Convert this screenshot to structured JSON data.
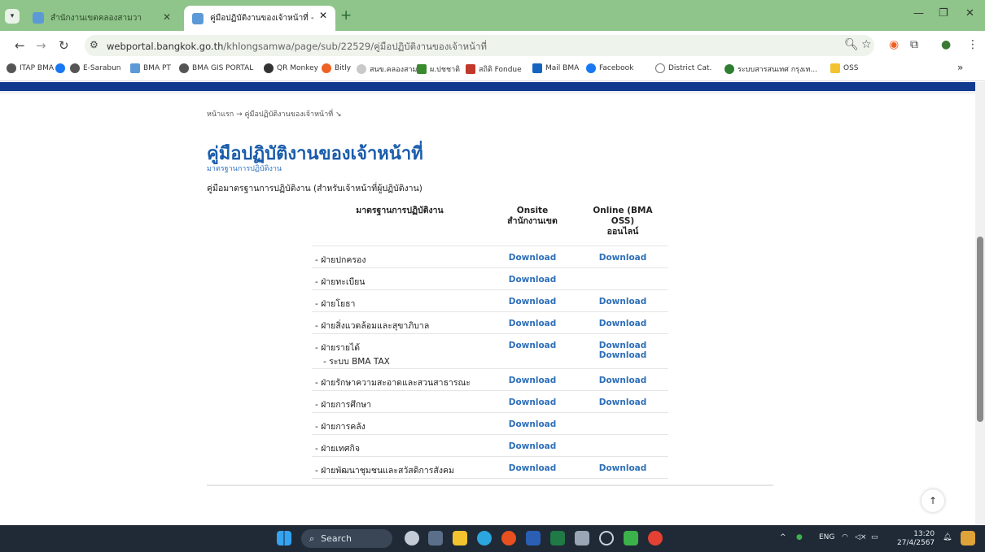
{
  "browser": {
    "tabs": [
      {
        "label": "สำนักงานเขตคลองสามวา",
        "active": false
      },
      {
        "label": "คู่มือปฏิบัติงานของเจ้าหน้าที่ - สำนัก",
        "active": true
      }
    ],
    "url_host": "webportal.bangkok.go.th",
    "url_path": "/khlongsamwa/page/sub/22529/คู่มือปฏิบัติงานของเจ้าหน้าที่",
    "bookmarks": [
      {
        "label": "ITAP BMA",
        "color": "#555555"
      },
      {
        "label": "",
        "color": "#1877f2"
      },
      {
        "label": "E-Sarabun",
        "color": "#555555"
      },
      {
        "label": "BMA PT",
        "color": "#5b9ad6"
      },
      {
        "label": "BMA GIS PORTAL",
        "color": "#555555"
      },
      {
        "label": "QR Monkey",
        "color": "#333333"
      },
      {
        "label": "Bitly",
        "color": "#ee6123"
      },
      {
        "label": "สนข.คลองสามวา",
        "color": "#c9c9c9"
      },
      {
        "label": "ผ.ปชชาติ",
        "color": "#3a8a2e"
      },
      {
        "label": "สถิติ Fondue",
        "color": "#c0392b"
      },
      {
        "label": "Mail BMA",
        "color": "#1565c0"
      },
      {
        "label": "Facebook",
        "color": "#1877f2"
      },
      {
        "label": "District Cat.",
        "color": "#777777"
      },
      {
        "label": "ระบบสารสนเทศ กรุงเท...",
        "color": "#2e7d32"
      },
      {
        "label": "OSS",
        "color": "#f2c230"
      }
    ],
    "more_bookmarks": "»"
  },
  "page": {
    "breadcrumb": "หน้าแรก → คู่มือปฏิบัติงานของเจ้าหน้าที่ ↘",
    "title": "คู่มือปฏิบัติงานของเจ้าหน้าที่",
    "subtitle": "มาตรฐานการปฏิบัติงาน",
    "caption": "คู่มือมาตรฐานการปฏิบัติงาน (สำหรับเจ้าหน้าที่ผู้ปฏิบัติงาน)",
    "table": {
      "headers": {
        "col1": "มาตรฐานการปฏิบัติงาน",
        "col2_line1": "Onsite",
        "col2_line2": "สำนักงานเขต",
        "col3_line1": "Online (BMA",
        "col3_line2": "OSS)",
        "col3_line3": "ออนไลน์"
      },
      "rows": [
        {
          "name": "- ฝ่ายปกครอง",
          "sub": "",
          "onsite": "Download",
          "online": "Download",
          "online_sub": ""
        },
        {
          "name": "- ฝ่ายทะเบียน",
          "sub": "",
          "onsite": "Download",
          "online": "",
          "online_sub": ""
        },
        {
          "name": "- ฝ่ายโยธา",
          "sub": "",
          "onsite": "Download",
          "online": "Download",
          "online_sub": ""
        },
        {
          "name": "- ฝ่ายสิ่งแวดล้อมและสุขาภิบาล",
          "sub": "",
          "onsite": "Download",
          "online": "Download",
          "online_sub": ""
        },
        {
          "name": "- ฝ่ายรายได้",
          "sub": "- ระบบ BMA TAX",
          "onsite": "Download",
          "online": "Download",
          "online_sub": "Download"
        },
        {
          "name": "- ฝ่ายรักษาความสะอาดและสวนสาธารณะ",
          "sub": "",
          "onsite": "Download",
          "online": "Download",
          "online_sub": ""
        },
        {
          "name": "- ฝ่ายการศึกษา",
          "sub": "",
          "onsite": "Download",
          "online": "Download",
          "online_sub": ""
        },
        {
          "name": "- ฝ่ายการคลัง",
          "sub": "",
          "onsite": "Download",
          "online": "",
          "online_sub": ""
        },
        {
          "name": "- ฝ่ายเทศกิจ",
          "sub": "",
          "onsite": "Download",
          "online": "",
          "online_sub": ""
        },
        {
          "name": "- ฝ่ายพัฒนาชุมชนและสวัสดิการสังคม",
          "sub": "",
          "onsite": "Download",
          "online": "Download",
          "online_sub": ""
        }
      ]
    },
    "back_to_top": "↑"
  },
  "taskbar": {
    "search_placeholder": "Search",
    "language": "ENG",
    "time": "13:20",
    "date": "27/4/2567"
  }
}
